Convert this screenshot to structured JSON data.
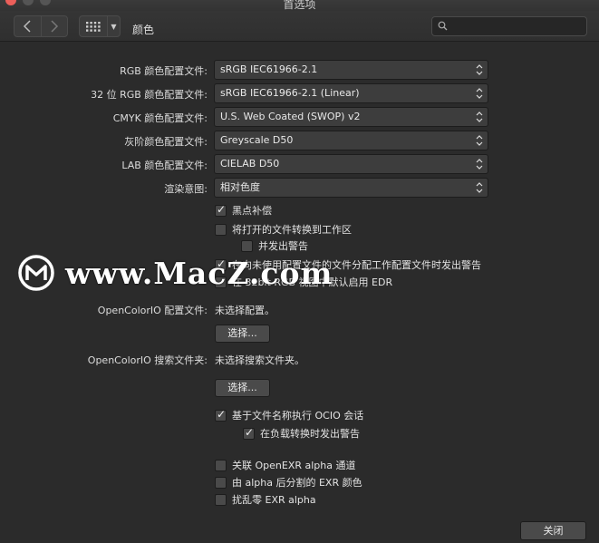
{
  "window": {
    "title": "首选项"
  },
  "toolbar": {
    "section": "颜色",
    "search_placeholder": ""
  },
  "profiles": [
    {
      "label": "RGB 颜色配置文件:",
      "value": "sRGB IEC61966-2.1"
    },
    {
      "label": "32 位 RGB 颜色配置文件:",
      "value": "sRGB IEC61966-2.1 (Linear)"
    },
    {
      "label": "CMYK 颜色配置文件:",
      "value": "U.S. Web Coated (SWOP) v2"
    },
    {
      "label": "灰阶颜色配置文件:",
      "value": "Greyscale D50"
    },
    {
      "label": "LAB 颜色配置文件:",
      "value": "CIELAB D50"
    },
    {
      "label": "渲染意图:",
      "value": "相对色度"
    }
  ],
  "options": {
    "black_point": {
      "label": "黑点补偿",
      "checked": true
    },
    "convert_open": {
      "label": "将打开的文件转换到工作区",
      "checked": false
    },
    "warn_convert": {
      "label": "并发出警告",
      "checked": false
    },
    "warn_unassigned": {
      "label": "在向未使用配置文件的文件分配工作配置文件时发出警告",
      "checked": true
    },
    "edr": {
      "label": "在 32bit RGB 视图中默认启用 EDR",
      "checked": false
    }
  },
  "ocio": {
    "config_label": "OpenColorIO 配置文件:",
    "config_value": "未选择配置。",
    "config_button": "选择...",
    "search_label": "OpenColorIO 搜索文件夹:",
    "search_value": "未选择搜索文件夹。",
    "search_button": "选择...",
    "by_filename": {
      "label": "基于文件名称执行 OCIO 会话",
      "checked": true
    },
    "warn_load": {
      "label": "在负载转换时发出警告",
      "checked": true
    }
  },
  "exr": {
    "assoc_alpha": {
      "label": "关联 OpenEXR alpha 通道",
      "checked": false
    },
    "separate_alpha": {
      "label": "由 alpha 后分割的 EXR 颜色",
      "checked": false
    },
    "zero_alpha": {
      "label": "扰乱零 EXR alpha",
      "checked": false
    }
  },
  "footer": {
    "close_label": "关闭"
  },
  "watermark": {
    "text": "www.MacZ.com"
  }
}
